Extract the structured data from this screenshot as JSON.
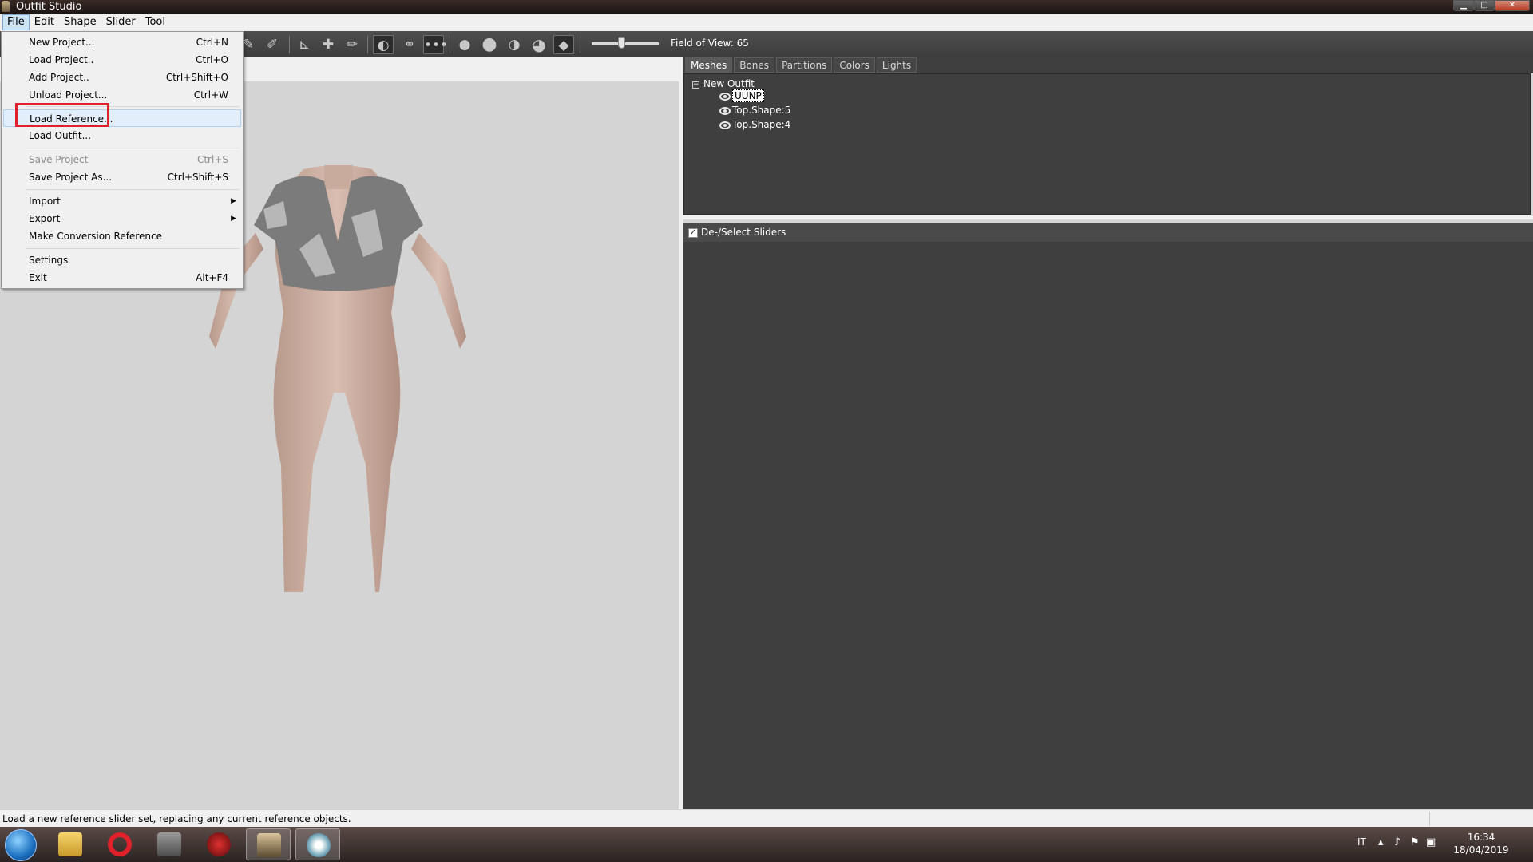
{
  "window": {
    "title": "Outfit Studio"
  },
  "menubar": [
    "File",
    "Edit",
    "Shape",
    "Slider",
    "Tool"
  ],
  "toolbar": {
    "fov_label": "Field of View: 65"
  },
  "file_menu": {
    "items": [
      {
        "label": "New Project...",
        "shortcut": "Ctrl+N"
      },
      {
        "label": "Load Project..",
        "shortcut": "Ctrl+O"
      },
      {
        "label": "Add Project..",
        "shortcut": "Ctrl+Shift+O"
      },
      {
        "label": "Unload Project...",
        "shortcut": "Ctrl+W"
      },
      {
        "label": "Load Reference...",
        "shortcut": ""
      },
      {
        "label": "Load Outfit...",
        "shortcut": ""
      },
      {
        "label": "Save Project",
        "shortcut": "Ctrl+S"
      },
      {
        "label": "Save Project As...",
        "shortcut": "Ctrl+Shift+S"
      },
      {
        "label": "Import",
        "shortcut": ""
      },
      {
        "label": "Export",
        "shortcut": ""
      },
      {
        "label": "Make Conversion Reference",
        "shortcut": ""
      },
      {
        "label": "Settings",
        "shortcut": ""
      },
      {
        "label": "Exit",
        "shortcut": "Alt+F4"
      }
    ]
  },
  "right_panel": {
    "tabs": [
      "Meshes",
      "Bones",
      "Partitions",
      "Colors",
      "Lights"
    ],
    "tree_root": "New Outfit",
    "meshes": [
      "UUNP",
      "Top.Shape:5",
      "Top.Shape:4"
    ],
    "sliders_toggle": "De-/Select Sliders"
  },
  "statusbar": {
    "text": "Load a new reference slider set, replacing any current reference objects."
  },
  "taskbar": {
    "lang": "IT",
    "time": "16:34",
    "date": "18/04/2019"
  },
  "colors": {
    "highlight": "#e0202a",
    "panel_dark": "#3f3f3f",
    "viewport": "#d4d4d4"
  }
}
